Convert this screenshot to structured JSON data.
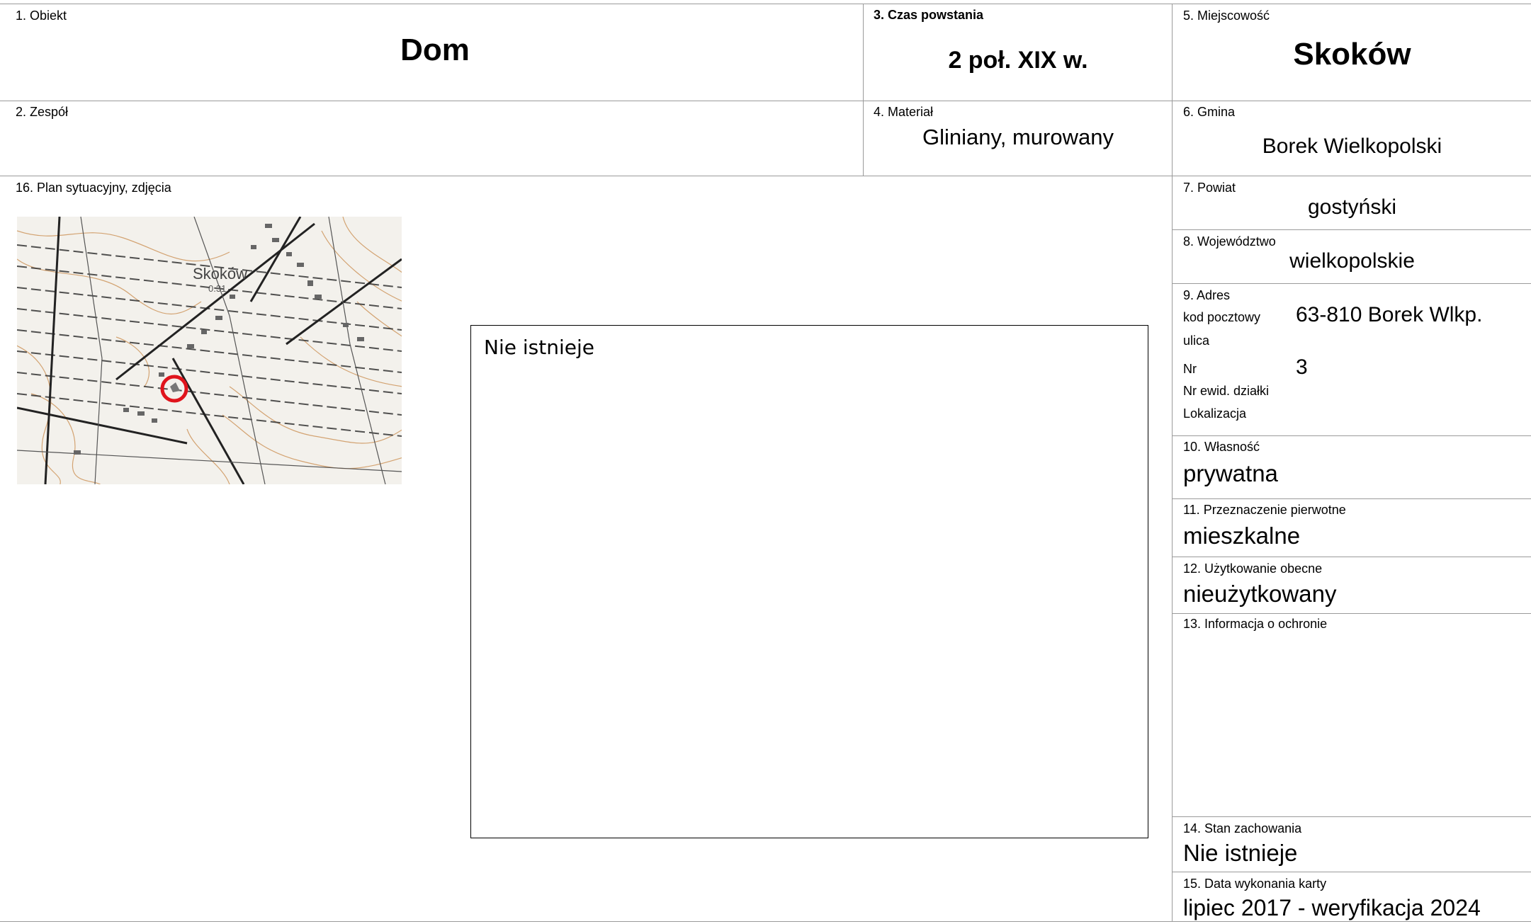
{
  "card": {
    "obiekt": {
      "label": "1. Obiekt",
      "value": "Dom"
    },
    "zespol": {
      "label": "2. Zespół",
      "value": ""
    },
    "czas": {
      "label": "3. Czas powstania",
      "value": "2 poł. XIX w."
    },
    "material": {
      "label": "4. Materiał",
      "value": "Gliniany, murowany"
    },
    "miejscowosc": {
      "label": "5. Miejscowość",
      "value": "Skoków"
    },
    "gmina": {
      "label": "6. Gmina",
      "value": "Borek Wielkopolski"
    },
    "powiat": {
      "label": "7. Powiat",
      "value": "gostyński"
    },
    "wojewodztwo": {
      "label": "8. Województwo",
      "value": "wielkopolskie"
    },
    "adres": {
      "label": "9. Adres",
      "kod_label": "kod pocztowy",
      "kod_value": "63-810 Borek Wlkp.",
      "ulica_label": "ulica",
      "nr_label": "Nr",
      "nr_value": "3",
      "dzialka_label": "Nr ewid. działki",
      "lokalizacja_label": "Lokalizacja"
    },
    "wlasnosc": {
      "label": "10. Własność",
      "value": "prywatna"
    },
    "przeznaczenie": {
      "label": "11. Przeznaczenie pierwotne",
      "value": "mieszkalne"
    },
    "uzytkowanie": {
      "label": "12. Użytkowanie obecne",
      "value": "nieużytkowany"
    },
    "ochrona": {
      "label": "13. Informacja o ochronie",
      "value": ""
    },
    "stan": {
      "label": "14. Stan zachowania",
      "value": "Nie istnieje"
    },
    "data": {
      "label": "15. Data wykonania karty",
      "value": "lipiec 2017 - weryfikacja 2024"
    },
    "plan": {
      "label": "16. Plan sytuacyjny, zdjęcia",
      "photo_text": "Nie istnieje"
    }
  },
  "map": {
    "place_label": "Skoków",
    "sub_label": "0.31",
    "marker_color": "#e0141c",
    "contour_color": "#c98a4a"
  }
}
